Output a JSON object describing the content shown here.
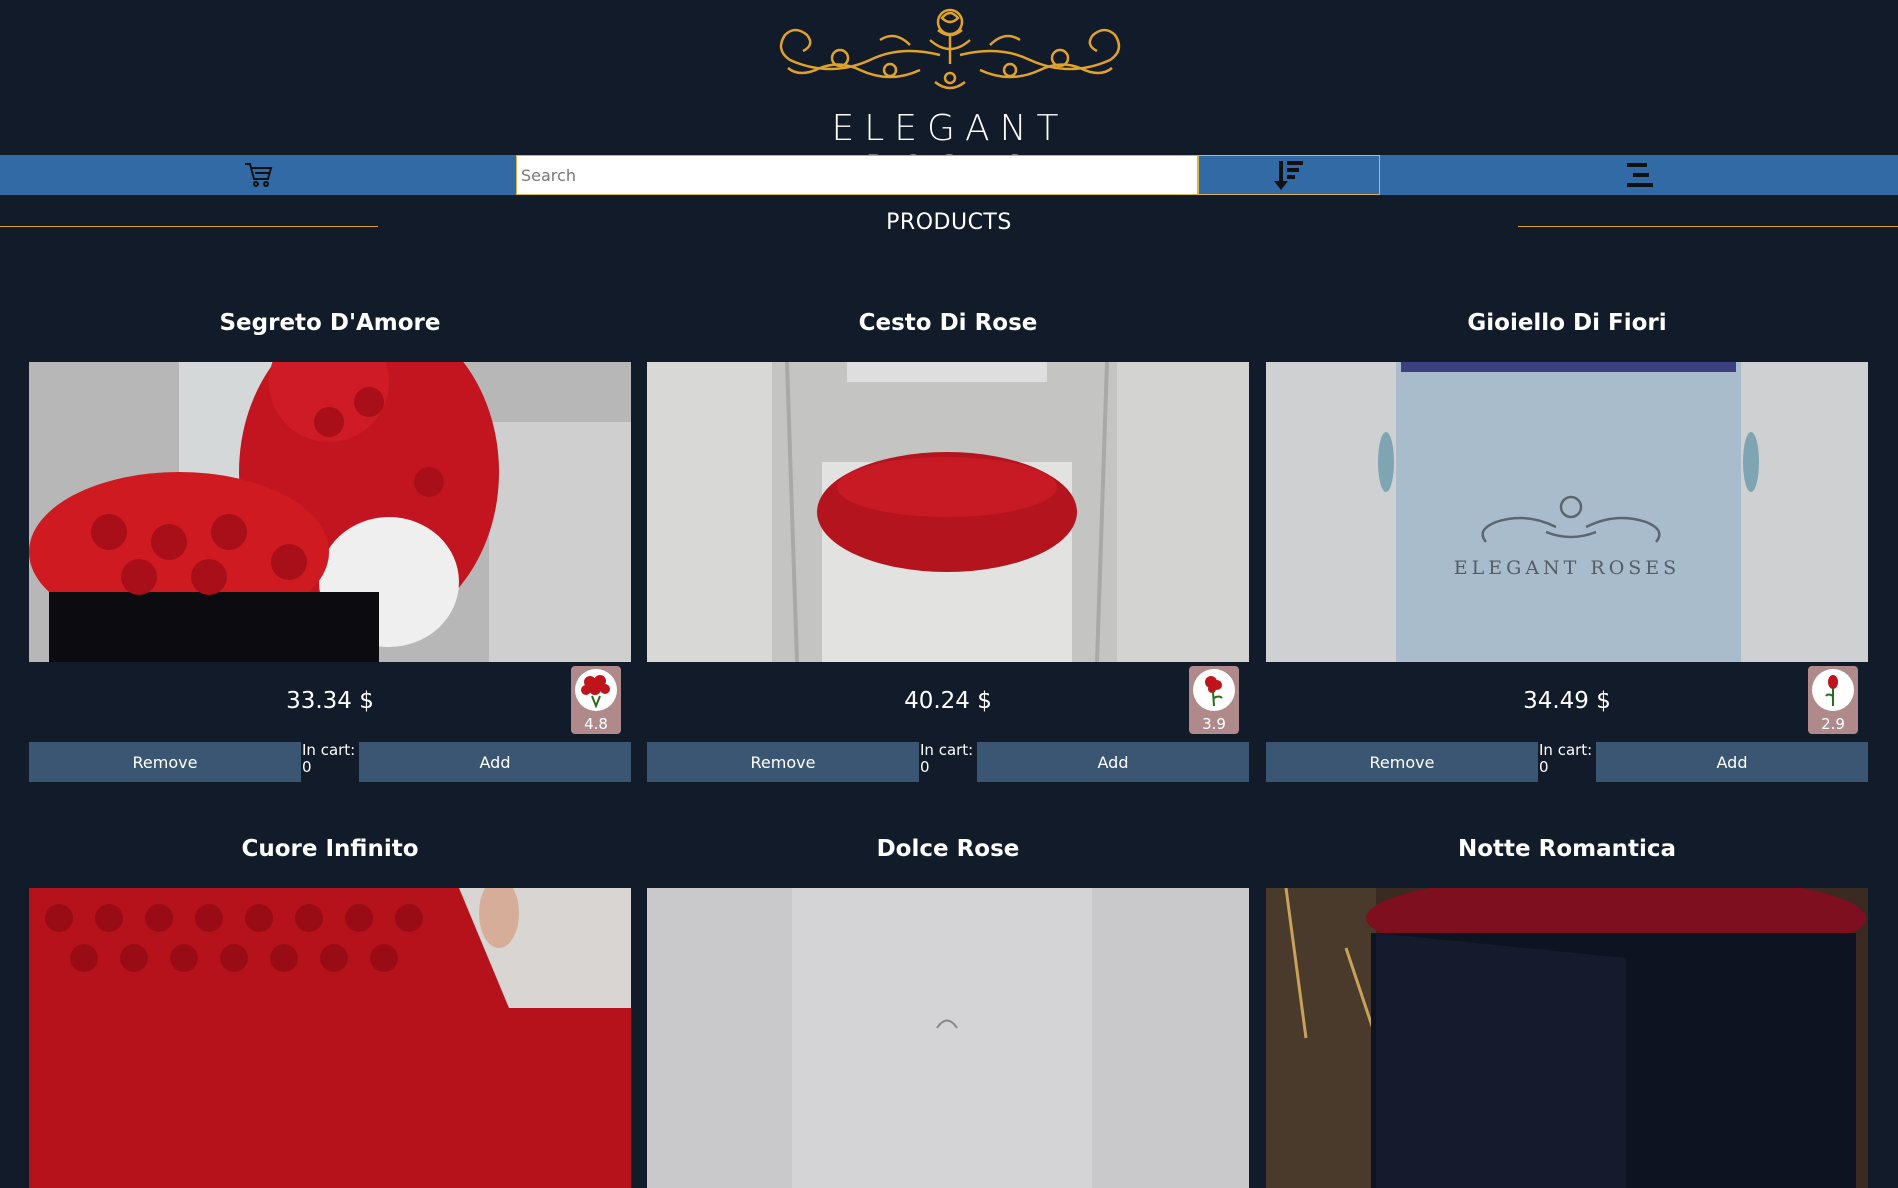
{
  "brand": {
    "name": "ELEGANT ROSES"
  },
  "navbar": {
    "cart_icon": "cart-icon",
    "search_placeholder": "Search",
    "sort_icon": "sort-descending-icon",
    "menu_icon": "menu-icon"
  },
  "section": {
    "title": "PRODUCTS"
  },
  "product_labels": {
    "remove": "Remove",
    "add": "Add",
    "in_cart": "In cart:"
  },
  "products": [
    {
      "name": "Segreto D'Amore",
      "price": "33.34 $",
      "rating": "4.8",
      "in_cart": "0"
    },
    {
      "name": "Cesto Di Rose",
      "price": "40.24 $",
      "rating": "3.9",
      "in_cart": "0"
    },
    {
      "name": "Gioiello Di Fiori",
      "price": "34.49 $",
      "rating": "2.9",
      "in_cart": "0"
    },
    {
      "name": "Cuore Infinito"
    },
    {
      "name": "Dolce Rose"
    },
    {
      "name": "Notte Romantica"
    }
  ],
  "colors": {
    "background": "#111b29",
    "navbar": "#326aa6",
    "gold": "#e0a22a",
    "button": "#3a5673"
  }
}
